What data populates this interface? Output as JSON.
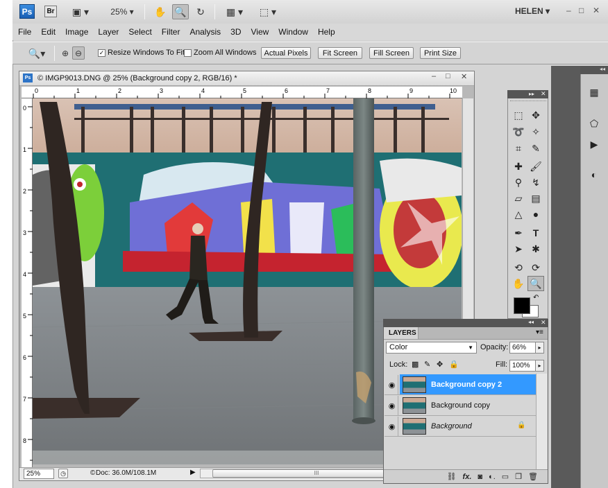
{
  "app": {
    "logo": "Ps",
    "bridge": "Br",
    "zoom_value": "25%",
    "workspace": "HELEN",
    "window_controls": [
      "–",
      "□",
      "✕"
    ]
  },
  "menu": [
    "File",
    "Edit",
    "Image",
    "Layer",
    "Select",
    "Filter",
    "Analysis",
    "3D",
    "View",
    "Window",
    "Help"
  ],
  "options": {
    "resize_windows": "Resize Windows To Fit",
    "zoom_all_windows": "Zoom All Windows",
    "actual_pixels": "Actual Pixels",
    "fit_screen": "Fit Screen",
    "fill_screen": "Fill Screen",
    "print_size": "Print Size",
    "resize_checked": true,
    "zoom_all_checked": false
  },
  "document": {
    "title": "© IMGP9013.DNG @ 25% (Background copy 2, RGB/16) *",
    "ruler_h": [
      "0",
      "1",
      "2",
      "3",
      "4",
      "5",
      "6",
      "7",
      "8",
      "9",
      "10"
    ],
    "ruler_v": [
      "0",
      "1",
      "2",
      "3",
      "4",
      "5",
      "6",
      "7",
      "8"
    ],
    "zoom": "25%",
    "doc_info": "Doc: 36.0M/108.1M",
    "scroll_label": "III"
  },
  "layers_panel": {
    "tab": "LAYERS",
    "blend_mode": "Color",
    "opacity_label": "Opacity:",
    "opacity": "66%",
    "lock_label": "Lock:",
    "fill_label": "Fill:",
    "fill": "100%",
    "layers": [
      {
        "name": "Background copy 2",
        "active": true,
        "italic": false
      },
      {
        "name": "Background copy",
        "active": false,
        "italic": false
      },
      {
        "name": "Background",
        "active": false,
        "italic": true,
        "locked": true
      }
    ]
  },
  "colors": {
    "accent": "#3399ff",
    "foreground_swatch": "#000000",
    "background_swatch": "#ffffff"
  }
}
